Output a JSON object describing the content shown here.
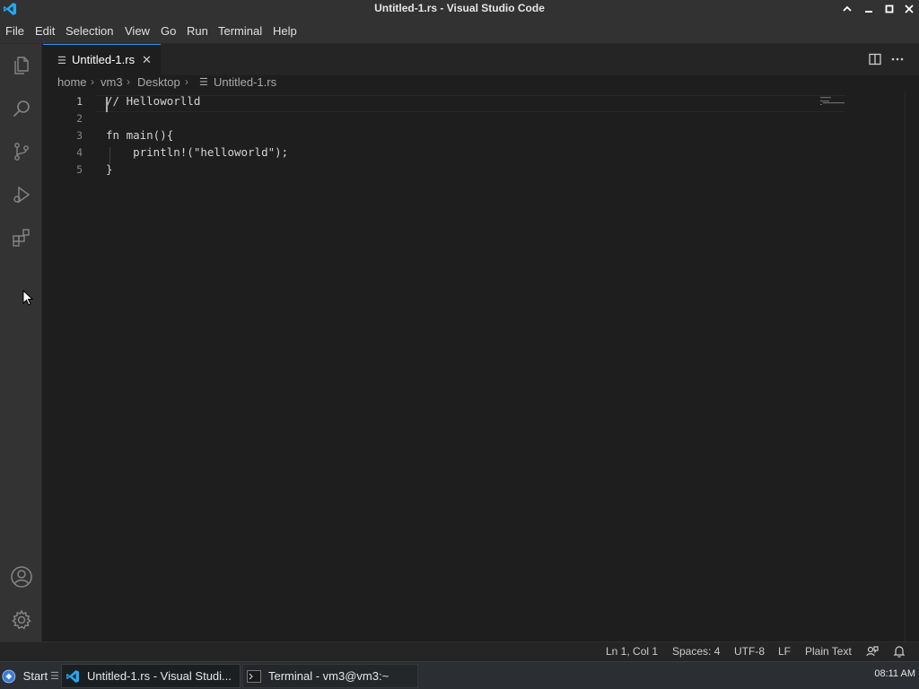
{
  "window": {
    "title": "Untitled-1.rs - Visual Studio Code"
  },
  "menu": [
    "File",
    "Edit",
    "Selection",
    "View",
    "Go",
    "Run",
    "Terminal",
    "Help"
  ],
  "activity_bar": {
    "top": [
      "explorer-icon",
      "search-icon",
      "source-control-icon",
      "run-debug-icon",
      "extensions-icon"
    ],
    "bottom": [
      "account-icon",
      "settings-gear-icon"
    ]
  },
  "tab": {
    "label": "Untitled-1.rs",
    "close": "✕"
  },
  "breadcrumbs": [
    "home",
    "vm3",
    "Desktop",
    "Untitled-1.rs"
  ],
  "editor": {
    "lines": [
      {
        "num": "1",
        "text": "// Helloworlld"
      },
      {
        "num": "2",
        "text": ""
      },
      {
        "num": "3",
        "text": "fn main(){"
      },
      {
        "num": "4",
        "text": "    println!(\"helloworld\");"
      },
      {
        "num": "5",
        "text": "}"
      }
    ]
  },
  "status": {
    "position": "Ln 1, Col 1",
    "spaces": "Spaces: 4",
    "encoding": "UTF-8",
    "eol": "LF",
    "language": "Plain Text"
  },
  "taskbar": {
    "start": "Start",
    "apps": [
      {
        "label": "Untitled-1.rs - Visual Studi..."
      },
      {
        "label": "Terminal - vm3@vm3:~"
      }
    ],
    "clock": "08:11 AM"
  },
  "colors": {
    "accent": "#3f8ef0",
    "vscode_blue": "#23a9f2"
  }
}
